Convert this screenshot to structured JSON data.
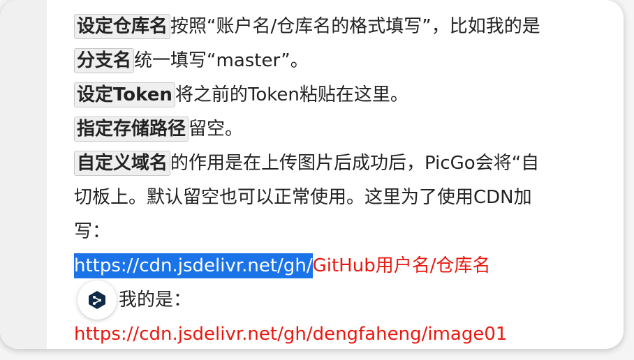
{
  "doc": {
    "line1": {
      "key": "设定仓库名",
      "text": "按照“账户名/仓库名的格式填写”，比如我的是"
    },
    "line2": {
      "key": "分支名",
      "text": "统一填写“master”。"
    },
    "line3": {
      "key": "设定Token",
      "text": "将之前的Token粘贴在这里。"
    },
    "line4": {
      "key": "指定存储路径",
      "text": "留空。"
    },
    "line5": {
      "key": "自定义域名",
      "text": "的作用是在上传图片后成功后，PicGo会将“自"
    },
    "line6": {
      "text": "切板上。默认留空也可以正常使用。这里为了使用CDN加"
    },
    "line7": {
      "text": "写："
    },
    "line8": {
      "selected": "https://cdn.jsdelivr.net/gh/",
      "red": "GitHub用户名/仓库名"
    },
    "line9": {
      "text": "我的是："
    },
    "line10": {
      "red": "https://cdn.jsdelivr.net/gh/dengfaheng/image01"
    }
  },
  "fab": {
    "icon": "deepl-icon"
  }
}
